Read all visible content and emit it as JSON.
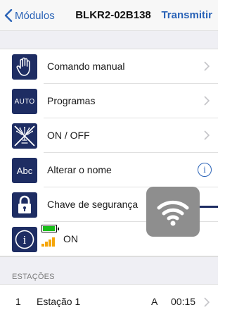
{
  "navbar": {
    "back_label": "Módulos",
    "title": "BLKR2-02B138",
    "action_label": "Transmitir"
  },
  "menu": [
    {
      "label": "Comando manual",
      "icon": "hand-icon",
      "accessory": "chevron"
    },
    {
      "label": "Programas",
      "icon": "auto-icon",
      "icon_text": "AUTO",
      "accessory": "chevron"
    },
    {
      "label": "ON / OFF",
      "icon": "sprinkler-off-icon",
      "accessory": "chevron"
    },
    {
      "label": "Alterar o nome",
      "icon": "abc-icon",
      "icon_text": "Abc",
      "accessory": "info"
    },
    {
      "label": "Chave de segurança",
      "icon": "padlock-icon",
      "accessory": "none"
    },
    {
      "label": "ON",
      "icon": "info-icon",
      "icon_text": "i",
      "accessory": "none"
    }
  ],
  "status": {
    "battery_color": "#1bbf1b",
    "signal_color": "#f5a60a"
  },
  "section": {
    "header": "ESTAÇÕES"
  },
  "stations": [
    {
      "number": "1",
      "name": "Estação 1",
      "program": "A",
      "time": "00:15"
    }
  ],
  "overlay": {
    "icon": "wifi-icon"
  },
  "colors": {
    "accent": "#2a63b7",
    "icon_bg": "#1e2d63",
    "group_bg": "#efeff4"
  }
}
